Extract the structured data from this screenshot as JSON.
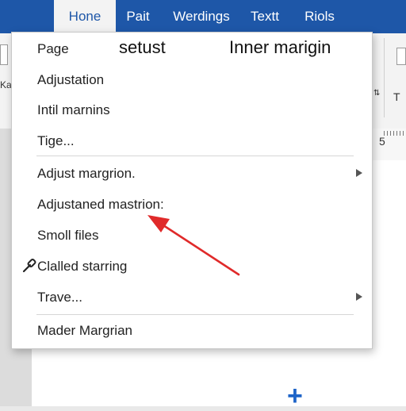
{
  "tabs": [
    {
      "label": "Hone",
      "active": true
    },
    {
      "label": "Pait",
      "active": false
    },
    {
      "label": "Werdings",
      "active": false
    },
    {
      "label": "Textt",
      "active": false
    },
    {
      "label": "Riols",
      "active": false
    }
  ],
  "ribbon": {
    "left_fragment": "Ka",
    "right_letter": "T",
    "ruler_number": "5"
  },
  "menu": {
    "first_item": "Page",
    "heading_setup": "setust",
    "heading_inner": "Inner marigin",
    "items": [
      {
        "label": "Adjustation"
      },
      {
        "label": "Intil marnins"
      },
      {
        "label": "Tige..."
      },
      {
        "label": "Adjust margrion.",
        "submenu": true
      },
      {
        "label": "Adjustaned mastrion:"
      },
      {
        "label": "Smoll files"
      },
      {
        "label": "Clalled starring",
        "icon": "brush-icon"
      },
      {
        "label": "Trave...",
        "submenu": true
      },
      {
        "label": "Mader Margrian"
      }
    ]
  },
  "annotation": {
    "arrow_color": "#e02a2a"
  },
  "colors": {
    "ribbon_blue": "#1e57a8",
    "plus_blue": "#1e64c8"
  },
  "page": {
    "add_icon": "plus-icon"
  }
}
